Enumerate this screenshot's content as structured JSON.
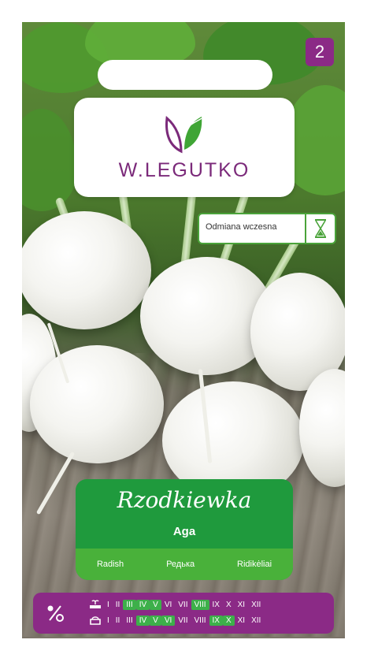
{
  "brand": {
    "name": "W.LEGUTKO",
    "color": "#7b2a7a"
  },
  "badge": {
    "number": "2",
    "color": "#8b2a86"
  },
  "early_variety": {
    "label": "Odmiana wczesna",
    "icon": "hourglass-icon"
  },
  "product": {
    "name": "Rzodkiewka",
    "variety": "Aga",
    "translations": [
      "Radish",
      "Редька",
      "Ridikėliai"
    ],
    "panel_color": "#1f9a3d"
  },
  "calendar": {
    "icon": "seed-percent-icon",
    "color": "#8b2a86",
    "months": [
      "I",
      "II",
      "III",
      "IV",
      "V",
      "VI",
      "VII",
      "VIII",
      "IX",
      "X",
      "XI",
      "XII"
    ],
    "rows": [
      {
        "icon": "sowing-icon",
        "highlight": [
          "III",
          "IV",
          "V",
          "VIII"
        ]
      },
      {
        "icon": "harvest-icon",
        "highlight": [
          "IV",
          "V",
          "VI",
          "IX",
          "X"
        ]
      }
    ]
  }
}
